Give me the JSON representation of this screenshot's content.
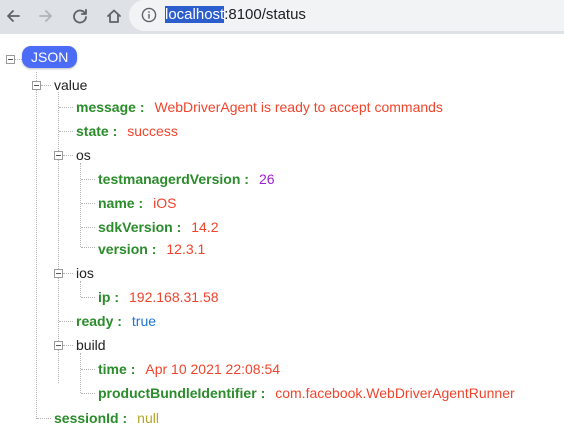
{
  "browser": {
    "url_host": "localhost",
    "url_rest": ":8100/status"
  },
  "tree": {
    "root_label": "JSON",
    "value_label": "value",
    "message": {
      "key": "message",
      "value": "WebDriverAgent is ready to accept commands"
    },
    "state": {
      "key": "state",
      "value": "success"
    },
    "os_label": "os",
    "testmanagerdVersion": {
      "key": "testmanagerdVersion",
      "value": "26"
    },
    "name": {
      "key": "name",
      "value": "iOS"
    },
    "sdkVersion": {
      "key": "sdkVersion",
      "value": "14.2"
    },
    "version": {
      "key": "version",
      "value": "12.3.1"
    },
    "ios_label": "ios",
    "ip": {
      "key": "ip",
      "value": "192.168.31.58"
    },
    "ready": {
      "key": "ready",
      "value": "true"
    },
    "build_label": "build",
    "time": {
      "key": "time",
      "value": "Apr 10 2021 22:08:54"
    },
    "productBundleIdentifier": {
      "key": "productBundleIdentifier",
      "value": "com.facebook.WebDriverAgentRunner"
    },
    "sessionId": {
      "key": "sessionId",
      "value": "null"
    },
    "separator": ":"
  },
  "colors": {
    "key": "#2a8c2a",
    "string": "#f0442c",
    "number": "#a01fd0",
    "boolean": "#1e74d4",
    "null": "#b5a629",
    "badge": "#4a6cf7"
  },
  "icons": [
    "back-arrow-icon",
    "forward-arrow-icon",
    "reload-icon",
    "info-icon",
    "collapse-toggle-icon"
  ]
}
